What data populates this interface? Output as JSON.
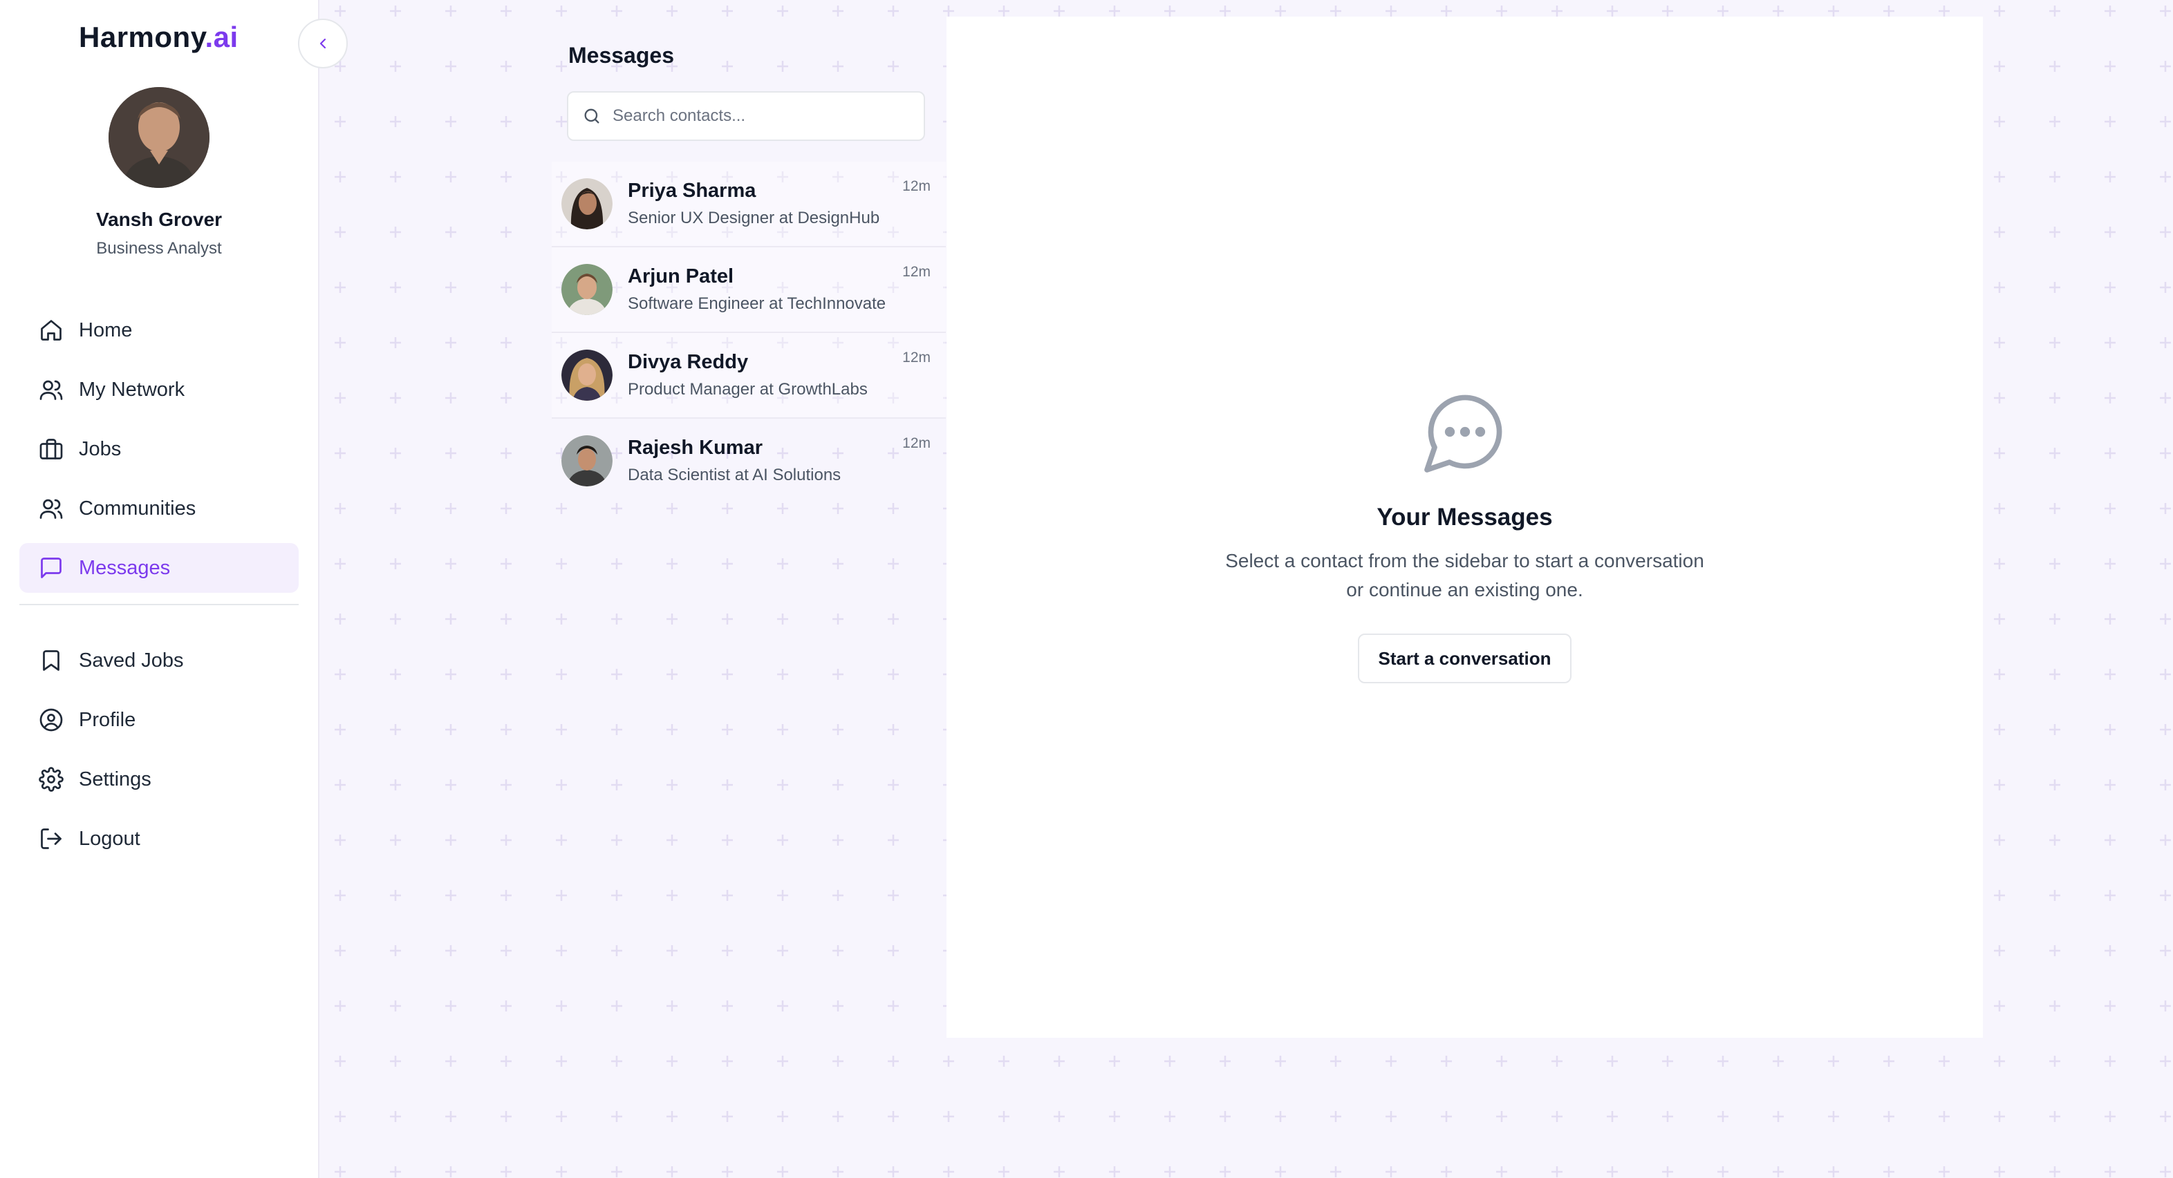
{
  "app": {
    "brand_main": "Harmony",
    "brand_accent": ".ai",
    "accent_color": "#7c3aed"
  },
  "user": {
    "name": "Vansh Grover",
    "role": "Business Analyst"
  },
  "nav": {
    "primary": [
      {
        "label": "Home",
        "icon": "home-icon"
      },
      {
        "label": "My Network",
        "icon": "users-icon"
      },
      {
        "label": "Jobs",
        "icon": "briefcase-icon"
      },
      {
        "label": "Communities",
        "icon": "users-icon"
      },
      {
        "label": "Messages",
        "icon": "message-square-icon",
        "active": true
      }
    ],
    "secondary": [
      {
        "label": "Saved Jobs",
        "icon": "bookmark-icon"
      },
      {
        "label": "Profile",
        "icon": "user-circle-icon"
      },
      {
        "label": "Settings",
        "icon": "gear-icon"
      },
      {
        "label": "Logout",
        "icon": "logout-icon"
      }
    ]
  },
  "messages": {
    "title": "Messages",
    "search_placeholder": "Search contacts...",
    "contacts": [
      {
        "name": "Priya Sharma",
        "title": "Senior UX Designer at DesignHub",
        "time": "12m"
      },
      {
        "name": "Arjun Patel",
        "title": "Software Engineer at TechInnovate",
        "time": "12m"
      },
      {
        "name": "Divya Reddy",
        "title": "Product Manager at GrowthLabs",
        "time": "12m"
      },
      {
        "name": "Rajesh Kumar",
        "title": "Data Scientist at AI Solutions",
        "time": "12m"
      }
    ]
  },
  "empty_state": {
    "title": "Your Messages",
    "desc_line1": "Select a contact from the sidebar to start a conversation",
    "desc_line2": "or continue an existing one.",
    "button": "Start a conversation"
  }
}
